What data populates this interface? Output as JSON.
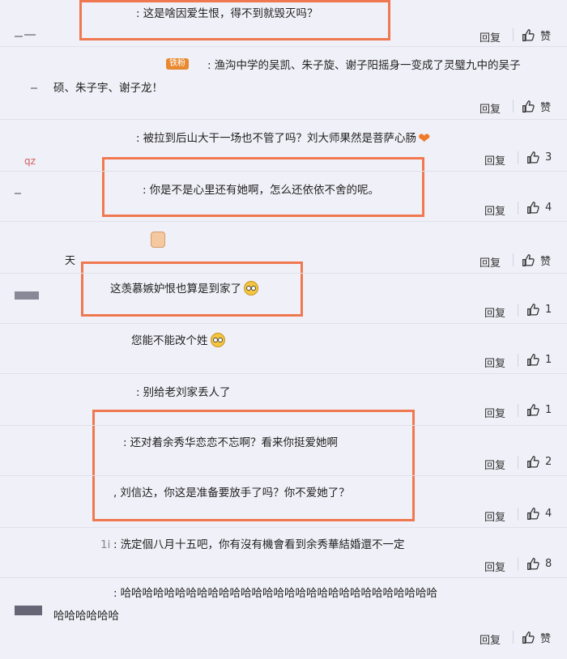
{
  "reply_label": "回复",
  "like_label": "赞",
  "comments": [
    {
      "text": "这是啥因爱生恨，得不到就毁灭吗？",
      "likes": "赞"
    },
    {
      "badge": "铁粉",
      "text_line1": "渔沟中学的吴凯、朱子旋、谢子阳摇身一变成了灵璧九中的吴子",
      "text_line2": "硕、朱子宇、谢子龙！",
      "likes": "赞"
    },
    {
      "text": "被拉到后山大干一场也不管了吗？刘大师果然是菩萨心肠",
      "tag": "qz",
      "likes": "3"
    },
    {
      "text": "你是不是心里还有她啊，怎么还依依不舍的呢。",
      "likes": "4"
    },
    {
      "name_tail": "天",
      "likes": "赞"
    },
    {
      "text": "这羡慕嫉妒恨也算是到家了",
      "likes": "1"
    },
    {
      "text": "您能不能改个姓",
      "likes": "1"
    },
    {
      "text": "别给老刘家丢人了",
      "likes": "1"
    },
    {
      "text": "还对着余秀华恋恋不忘啊？看来你挺爱她啊",
      "likes": "2"
    },
    {
      "text": "刘信达，你这是准备要放手了吗？你不爱她了？",
      "likes": "4"
    },
    {
      "name_tail": "1i",
      "text": "洗定個八月十五吧，你有沒有機會看到余秀華結婚還不一定",
      "likes": "8"
    },
    {
      "text_line1": "哈哈哈哈哈哈哈哈哈哈哈哈哈哈哈哈哈哈哈哈哈哈哈哈哈哈哈哈哈",
      "text_line2": "哈哈哈哈哈哈",
      "likes": "赞"
    }
  ],
  "colors": {
    "highlight_border": "#f07850",
    "badge": "#e8892f",
    "heart": "#f07a2a"
  }
}
